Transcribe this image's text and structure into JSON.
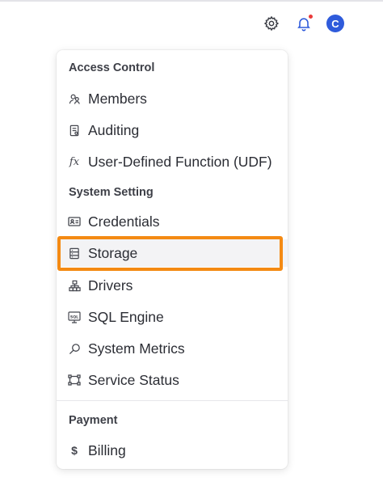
{
  "header": {
    "settings_icon": "gear-icon",
    "notifications_icon": "bell-icon",
    "notification_dot_color": "#ea3b3b",
    "avatar_initial": "C",
    "avatar_color": "#2f5bdb"
  },
  "menu": {
    "sections": [
      {
        "title": "Access Control",
        "items": [
          {
            "label": "Members",
            "icon": "members-icon"
          },
          {
            "label": "Auditing",
            "icon": "auditing-icon"
          },
          {
            "label": "User-Defined Function (UDF)",
            "icon": "function-icon",
            "glyph": "fx"
          }
        ]
      },
      {
        "title": "System Setting",
        "items": [
          {
            "label": "Credentials",
            "icon": "credentials-icon"
          },
          {
            "label": "Storage",
            "icon": "storage-icon",
            "active": true
          },
          {
            "label": "Drivers",
            "icon": "drivers-icon"
          },
          {
            "label": "SQL Engine",
            "icon": "sql-engine-icon"
          },
          {
            "label": "System Metrics",
            "icon": "system-metrics-icon"
          },
          {
            "label": "Service Status",
            "icon": "service-status-icon"
          }
        ]
      },
      {
        "title": "Payment",
        "items": [
          {
            "label": "Billing",
            "icon": "billing-icon",
            "glyph": "$"
          }
        ]
      }
    ]
  },
  "highlight_color": "#f48a13"
}
